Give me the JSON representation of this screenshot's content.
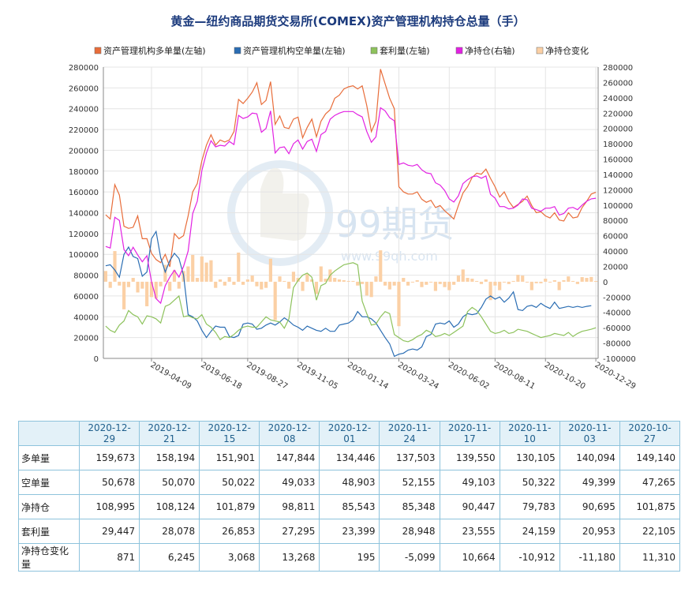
{
  "chart_data": {
    "type": "line",
    "title": "黄金—纽约商品期货交易所(COMEX)资产管理机构持仓总量（手）",
    "legend_position": "top",
    "grid": true,
    "y_left": {
      "min": 0,
      "max": 280000,
      "step": 20000
    },
    "y_right": {
      "min": -100000,
      "max": 280000,
      "step": 20000
    },
    "x_tick_labels": [
      "2019-04-09",
      "2019-06-18",
      "2019-08-27",
      "2019-11-05",
      "2020-01-14",
      "2020-03-24",
      "2020-06-02",
      "2020-08-11",
      "2020-10-20",
      "2020-12-29"
    ],
    "series": [
      {
        "name": "资产管理机构多单量(左轴)",
        "type": "line",
        "axis": "left",
        "color": "#e86d3a",
        "values": [
          138000,
          134000,
          167000,
          157000,
          127000,
          125000,
          126000,
          137000,
          115000,
          115000,
          101000,
          95000,
          92000,
          100000,
          88000,
          120000,
          115000,
          118000,
          137000,
          160000,
          168000,
          190000,
          205000,
          215000,
          205000,
          210000,
          208000,
          210000,
          218000,
          249000,
          245000,
          250000,
          256000,
          265000,
          244000,
          248000,
          266000,
          225000,
          233000,
          222000,
          221000,
          230000,
          232000,
          212000,
          222000,
          230000,
          213000,
          228000,
          235000,
          239000,
          250000,
          253000,
          259000,
          261000,
          262000,
          259000,
          262000,
          243000,
          218000,
          228000,
          278000,
          264000,
          250000,
          240000,
          165000,
          160000,
          158000,
          158000,
          160000,
          153000,
          150000,
          152000,
          145000,
          147000,
          142000,
          138000,
          134000,
          147000,
          159000,
          165000,
          174000,
          178000,
          177000,
          182000,
          173000,
          165000,
          155000,
          160000,
          151000,
          145000,
          148000,
          151000,
          156000,
          147000,
          140000,
          141000,
          137000,
          135000,
          140000,
          133000,
          132000,
          140000,
          135000,
          136000,
          145000,
          151000,
          158000,
          159673
        ]
      },
      {
        "name": "资产管理机构空单量(左轴)",
        "type": "line",
        "axis": "left",
        "color": "#2a6db3",
        "values": [
          89000,
          90000,
          85000,
          78000,
          100000,
          107000,
          98000,
          96000,
          79000,
          83000,
          115000,
          122000,
          97000,
          83000,
          94000,
          101000,
          96000,
          80000,
          42000,
          40000,
          36000,
          27000,
          20000,
          26000,
          31000,
          30000,
          30000,
          21000,
          20000,
          22000,
          33000,
          34000,
          33000,
          28000,
          29000,
          32000,
          34000,
          32000,
          35000,
          39000,
          36000,
          32000,
          30000,
          27000,
          31000,
          29000,
          27000,
          26000,
          29000,
          26000,
          26000,
          32000,
          33000,
          34000,
          37000,
          45000,
          40000,
          40000,
          38000,
          34000,
          27000,
          20000,
          14000,
          2000,
          4000,
          5000,
          8000,
          9000,
          8000,
          11000,
          21000,
          23000,
          33000,
          34000,
          33000,
          36000,
          30000,
          33000,
          40000,
          43000,
          42000,
          43000,
          49000,
          57000,
          60000,
          57000,
          59000,
          54000,
          58000,
          64000,
          47000,
          46000,
          50000,
          51000,
          49000,
          53000,
          50000,
          48000,
          54000,
          48000,
          49000,
          50000,
          49000,
          50000,
          49000,
          50000,
          50678
        ]
      },
      {
        "name": "套利量(左轴)",
        "type": "line",
        "axis": "left",
        "color": "#8dc25c",
        "values": [
          31000,
          27000,
          25000,
          32000,
          36000,
          46000,
          42000,
          40000,
          33000,
          41000,
          40000,
          38000,
          34000,
          50000,
          52000,
          56000,
          60000,
          40000,
          41000,
          39000,
          38000,
          42000,
          33000,
          30000,
          25000,
          18000,
          21000,
          20000,
          23000,
          27000,
          30000,
          31000,
          30000,
          30000,
          35000,
          40000,
          37000,
          36000,
          35000,
          29000,
          38000,
          68000,
          75000,
          80000,
          82000,
          78000,
          56000,
          70000,
          72000,
          80000,
          84000,
          87000,
          90000,
          91000,
          92000,
          90000,
          55000,
          43000,
          32000,
          33000,
          40000,
          45000,
          43000,
          23000,
          20000,
          17000,
          16000,
          18000,
          21000,
          23000,
          27000,
          25000,
          21000,
          22000,
          24000,
          22000,
          25000,
          28000,
          31000,
          45000,
          49000,
          46000,
          40000,
          33000,
          26000,
          24000,
          25000,
          27000,
          24000,
          25000,
          28000,
          27000,
          26000,
          24000,
          22000,
          20000,
          21000,
          22000,
          24000,
          23000,
          22000,
          25000,
          21000,
          24000,
          26000,
          27000,
          28000,
          29447
        ]
      },
      {
        "name": "净持仓(右轴)",
        "type": "line",
        "axis": "right",
        "color": "#e221e2",
        "values": [
          46000,
          44000,
          84000,
          80000,
          42000,
          34000,
          45000,
          35000,
          26000,
          34000,
          0,
          -22000,
          -28000,
          -5000,
          6000,
          15000,
          6000,
          20000,
          40000,
          89000,
          105000,
          145000,
          168000,
          184000,
          176000,
          178000,
          177000,
          183000,
          179000,
          217000,
          213000,
          215000,
          220000,
          219000,
          195000,
          200000,
          223000,
          168000,
          175000,
          176000,
          167000,
          180000,
          185000,
          173000,
          183000,
          186000,
          170000,
          192000,
          196000,
          212000,
          217000,
          220000,
          222000,
          222000,
          222000,
          218000,
          215000,
          196000,
          182000,
          189000,
          227000,
          223000,
          214000,
          210000,
          153000,
          155000,
          152000,
          151000,
          153000,
          146000,
          142000,
          141000,
          129000,
          126000,
          119000,
          108000,
          104000,
          112000,
          128000,
          133000,
          137000,
          138000,
          135000,
          138000,
          114000,
          109000,
          98000,
          98000,
          95000,
          96000,
          100000,
          108000,
          107000,
          96000,
          94000,
          92000,
          96000,
          96000,
          98000,
          87000,
          89000,
          96000,
          97000,
          94000,
          100000,
          105000,
          108124,
          108995
        ]
      },
      {
        "name": "净持仓变化",
        "type": "bar",
        "axis": "right",
        "color": "#fbd0a5",
        "values": [
          14000,
          -8000,
          40000,
          -5000,
          -36000,
          -7000,
          5000,
          -14000,
          -9000,
          -32000,
          -20000,
          -22000,
          -6000,
          22000,
          -12000,
          15000,
          -9000,
          14000,
          20000,
          35000,
          5000,
          33000,
          25000,
          28000,
          -8000,
          3000,
          -5000,
          6000,
          -4000,
          38000,
          -4000,
          3000,
          8000,
          -6000,
          -10000,
          -8000,
          30000,
          -50000,
          7000,
          1000,
          -9000,
          13000,
          5000,
          -12000,
          10000,
          3000,
          -16000,
          20000,
          4000,
          16000,
          5000,
          3000,
          2000,
          1000,
          1000,
          -5000,
          -3000,
          -18000,
          -20000,
          7000,
          41000,
          -5000,
          -10000,
          -5000,
          -58000,
          5000,
          -5000,
          -1000,
          2000,
          -7000,
          -4000,
          -1000,
          -12000,
          -3000,
          -7000,
          -11000,
          -4000,
          8000,
          16000,
          5000,
          4000,
          1000,
          -3000,
          3000,
          -24000,
          -5000,
          -11000,
          0,
          -3000,
          1000,
          9000,
          8000,
          -1000,
          -11000,
          -2000,
          -2000,
          4000,
          0,
          2000,
          -11000,
          2000,
          7000,
          1000,
          -3000,
          6000,
          5000,
          6245,
          871
        ]
      }
    ]
  },
  "table": {
    "dates": [
      "2020-12-29",
      "2020-12-21",
      "2020-12-15",
      "2020-12-08",
      "2020-12-01",
      "2020-11-24",
      "2020-11-17",
      "2020-11-10",
      "2020-11-03",
      "2020-10-27"
    ],
    "rows": [
      {
        "label": "多单量",
        "values": [
          "159,673",
          "158,194",
          "151,901",
          "147,844",
          "134,446",
          "137,503",
          "139,550",
          "130,105",
          "140,094",
          "149,140"
        ]
      },
      {
        "label": "空单量",
        "values": [
          "50,678",
          "50,070",
          "50,022",
          "49,033",
          "48,903",
          "52,155",
          "49,103",
          "50,322",
          "49,399",
          "47,265"
        ]
      },
      {
        "label": "净持仓",
        "values": [
          "108,995",
          "108,124",
          "101,879",
          "98,811",
          "85,543",
          "85,348",
          "90,447",
          "79,783",
          "90,695",
          "101,875"
        ]
      },
      {
        "label": "套利量",
        "values": [
          "29,447",
          "28,078",
          "26,853",
          "27,295",
          "23,399",
          "28,948",
          "23,555",
          "24,159",
          "20,953",
          "22,105"
        ]
      },
      {
        "label": "净持仓变化量",
        "values": [
          "871",
          "6,245",
          "3,068",
          "13,268",
          "195",
          "-5,099",
          "10,664",
          "-10,912",
          "-11,180",
          "11,310"
        ]
      }
    ]
  },
  "watermark": {
    "brand": "99期货",
    "url": "www.99qh.com"
  }
}
